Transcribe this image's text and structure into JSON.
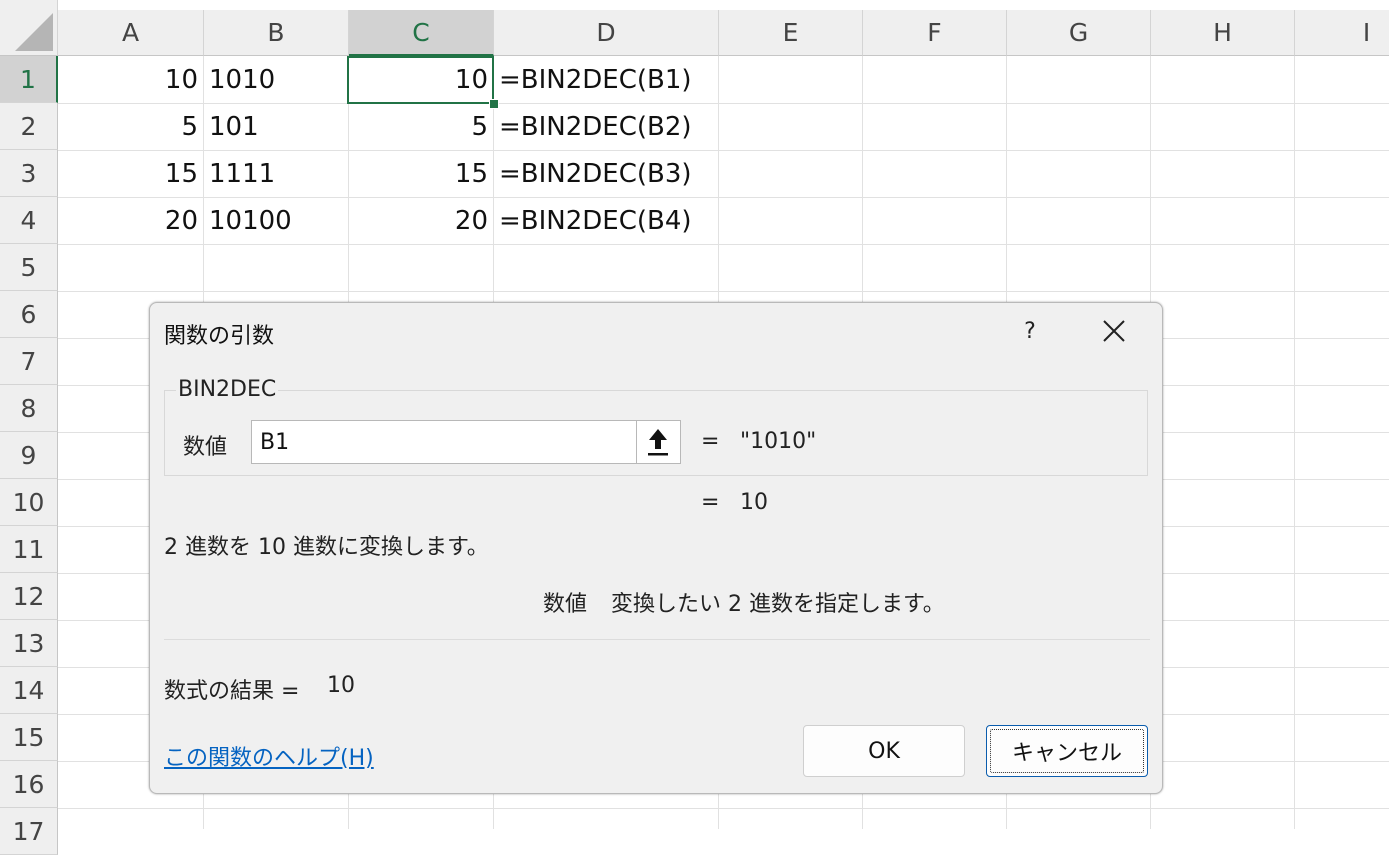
{
  "sheet": {
    "columns": [
      "A",
      "B",
      "C",
      "D",
      "E",
      "F",
      "G",
      "H",
      "I"
    ],
    "active_column": "C",
    "rows": [
      "1",
      "2",
      "3",
      "4",
      "5",
      "6",
      "7",
      "8",
      "9",
      "10",
      "11",
      "12",
      "13",
      "14",
      "15",
      "16",
      "17"
    ],
    "active_row": "1",
    "cells": [
      {
        "a": "10",
        "b": "1010",
        "c": "10",
        "d": "=BIN2DEC(B1)"
      },
      {
        "a": "5",
        "b": "101",
        "c": "5",
        "d": "=BIN2DEC(B2)"
      },
      {
        "a": "15",
        "b": "1111",
        "c": "15",
        "d": "=BIN2DEC(B3)"
      },
      {
        "a": "20",
        "b": "10100",
        "c": "20",
        "d": "=BIN2DEC(B4)"
      }
    ],
    "selected_cell": "C1"
  },
  "dialog": {
    "title": "関数の引数",
    "help_glyph": "?",
    "function_name": "BIN2DEC",
    "arg_label": "数値",
    "arg_value": "B1",
    "equals": "=",
    "arg_result": "\"1010\"",
    "func_result": "10",
    "description": "2 進数を 10 進数に変換します。",
    "arg_desc_name": "数値",
    "arg_desc_text": "変換したい 2 進数を指定します。",
    "formula_result_label": "数式の結果 =",
    "formula_result_value": "10",
    "help_link": "この関数のヘルプ(H)",
    "ok_label": "OK",
    "cancel_label": "キャンセル"
  },
  "colors": {
    "accent": "#217346",
    "link": "#0563c1",
    "dialog_bg": "#f0f0f0"
  },
  "icons": [
    "select-all-icon",
    "help-icon",
    "close-icon",
    "collapse-dialog-arrow-icon"
  ]
}
